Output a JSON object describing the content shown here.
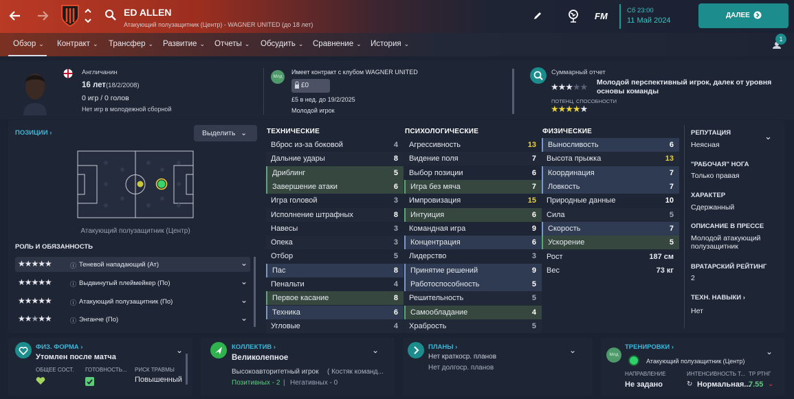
{
  "header": {
    "player_name": "ED ALLEN",
    "player_subtitle": "Атакующий полузащитник (Центр) - WAGNER UNITED (до 18 лет)",
    "fm_label": "FM",
    "date_time": "Сб 23:00",
    "date": "11 Май 2024",
    "continue_label": "ДАЛЕЕ",
    "notification_count": "1"
  },
  "nav": {
    "tabs": [
      "Обзор",
      "Контракт",
      "Трансфер",
      "Развитие",
      "Отчеты",
      "Обсудить",
      "Сравнение",
      "История"
    ]
  },
  "profile": {
    "nationality": "Англичанин",
    "age": "16 лет",
    "birthdate": "(18/2/2008)",
    "games_goals": "0 игр / 0 голов",
    "youth_caps": "Нет игр в молодежной сборной",
    "contract_badge": "Млд",
    "contract_title": "Имеет контракт с клубом WAGNER UNITED",
    "value": "£0",
    "wage": "£5 в нед. до 19/2/2025",
    "contract_type": "Молодой игрок",
    "report_title": "Суммарный отчет",
    "report_text": "Молодой перспективный игрок, далек от уровня основы команды",
    "potential_label": "ПОТЕНЦ. СПОСОБНОСТИ",
    "ability_stars": 3,
    "potential_stars": 4.5
  },
  "positions": {
    "title": "ПОЗИЦИИ",
    "select_label": "Выделить",
    "position_name": "Атакующий полузащитник (Центр)",
    "roles_title": "РОЛЬ И ОБЯЗАННОСТЬ",
    "roles": [
      {
        "name": "Теневой нападающий (Ат)",
        "stars": 3
      },
      {
        "name": "Выдвинутый плеймейкер (По)",
        "stars": 3
      },
      {
        "name": "Атакующий полузащитник (По)",
        "stars": 3
      },
      {
        "name": "Энганче (По)",
        "stars": 2.5
      }
    ]
  },
  "technical": {
    "title": "ТЕХНИЧЕСКИЕ",
    "rows": [
      {
        "name": "Вброс из-за боковой",
        "value": "4",
        "hl": ""
      },
      {
        "name": "Дальние удары",
        "value": "8",
        "hl": ""
      },
      {
        "name": "Дриблинг",
        "value": "5",
        "hl": "green"
      },
      {
        "name": "Завершение атаки",
        "value": "6",
        "hl": "green"
      },
      {
        "name": "Игра головой",
        "value": "3",
        "hl": ""
      },
      {
        "name": "Исполнение штрафных",
        "value": "8",
        "hl": ""
      },
      {
        "name": "Навесы",
        "value": "3",
        "hl": ""
      },
      {
        "name": "Опека",
        "value": "3",
        "hl": ""
      },
      {
        "name": "Отбор",
        "value": "5",
        "hl": ""
      },
      {
        "name": "Пас",
        "value": "8",
        "hl": "blue"
      },
      {
        "name": "Пенальти",
        "value": "4",
        "hl": ""
      },
      {
        "name": "Первое касание",
        "value": "8",
        "hl": "green"
      },
      {
        "name": "Техника",
        "value": "6",
        "hl": "blue"
      },
      {
        "name": "Угловые",
        "value": "4",
        "hl": ""
      }
    ]
  },
  "mental": {
    "title": "ПСИХОЛОГИЧЕСКИЕ",
    "rows": [
      {
        "name": "Агрессивность",
        "value": "13",
        "hl": "",
        "c": "y"
      },
      {
        "name": "Видение поля",
        "value": "7",
        "hl": ""
      },
      {
        "name": "Выбор позиции",
        "value": "6",
        "hl": ""
      },
      {
        "name": "Игра без мяча",
        "value": "7",
        "hl": "green"
      },
      {
        "name": "Импровизация",
        "value": "15",
        "hl": "",
        "c": "y"
      },
      {
        "name": "Интуиция",
        "value": "6",
        "hl": "green"
      },
      {
        "name": "Командная игра",
        "value": "9",
        "hl": ""
      },
      {
        "name": "Концентрация",
        "value": "6",
        "hl": "blue"
      },
      {
        "name": "Лидерство",
        "value": "3",
        "hl": ""
      },
      {
        "name": "Принятие решений",
        "value": "9",
        "hl": "blue"
      },
      {
        "name": "Работоспособность",
        "value": "5",
        "hl": "blue"
      },
      {
        "name": "Решительность",
        "value": "5",
        "hl": ""
      },
      {
        "name": "Самообладание",
        "value": "4",
        "hl": "green"
      },
      {
        "name": "Храбрость",
        "value": "5",
        "hl": ""
      }
    ]
  },
  "physical": {
    "title": "ФИЗИЧЕСКИЕ",
    "rows": [
      {
        "name": "Выносливость",
        "value": "6",
        "hl": "blue"
      },
      {
        "name": "Высота прыжка",
        "value": "13",
        "hl": "",
        "c": "y"
      },
      {
        "name": "Координация",
        "value": "7",
        "hl": "blue"
      },
      {
        "name": "Ловкость",
        "value": "7",
        "hl": "blue"
      },
      {
        "name": "Природные данные",
        "value": "10",
        "hl": ""
      },
      {
        "name": "Сила",
        "value": "5",
        "hl": ""
      },
      {
        "name": "Скорость",
        "value": "7",
        "hl": "blue"
      },
      {
        "name": "Ускорение",
        "value": "5",
        "hl": "green"
      }
    ],
    "height_label": "Рост",
    "height": "187 см",
    "weight_label": "Вес",
    "weight": "73 кг"
  },
  "side": {
    "reputation_label": "РЕПУТАЦИЯ",
    "reputation": "Неясная",
    "foot_label": "\"РАБОЧАЯ\" НОГА",
    "foot": "Только правая",
    "character_label": "ХАРАКТЕР",
    "character": "Сдержанный",
    "press_label": "ОПИСАНИЕ В ПРЕССЕ",
    "press": "Молодой атакующий полузащитник",
    "gk_label": "ВРАТАРСКИЙ РЕЙТИНГ",
    "gk": "2",
    "tech_label": "ТЕХН. НАВЫКИ",
    "tech": "Нет"
  },
  "bottom": {
    "fitness_title": "ФИЗ. ФОРМА",
    "fitness_status": "Утомлен после матча",
    "overall_label": "ОБЩЕЕ СОСТ.",
    "ready_label": "ГОТОВНОСТЬ...",
    "injury_label": "РИСК ТРАВМЫ",
    "injury_value": "Повышенный",
    "team_title": "КОЛЛЕКТИВ",
    "team_status": "Великолепное",
    "team_desc": "Высокоавторитетный игрок",
    "team_desc2": "( Костяк команд...",
    "positives": "Позитивных - 2",
    "negatives": "Негативных - 0",
    "plans_title": "ПЛАНЫ",
    "plans_short": "Нет краткоср. планов",
    "plans_long": "Нет долгоср. планов",
    "training_title": "ТРЕНИРОВКИ",
    "training_badge": "Млд",
    "training_role": "Атакующий полузащитник (Центр)",
    "direction_label": "НАПРАВЛЕНИЕ",
    "direction": "Не задано",
    "intensity_label": "ИНТЕНСИВНОСТЬ Т...",
    "intensity": "Нормальная...",
    "rating_label": "ТР РТНГ",
    "rating": "7.55"
  },
  "colors": {
    "accent_teal": "#1c8c8c",
    "green": "#5ccb7a",
    "yellow": "#e9d238",
    "brand_red": "#b93a25"
  }
}
